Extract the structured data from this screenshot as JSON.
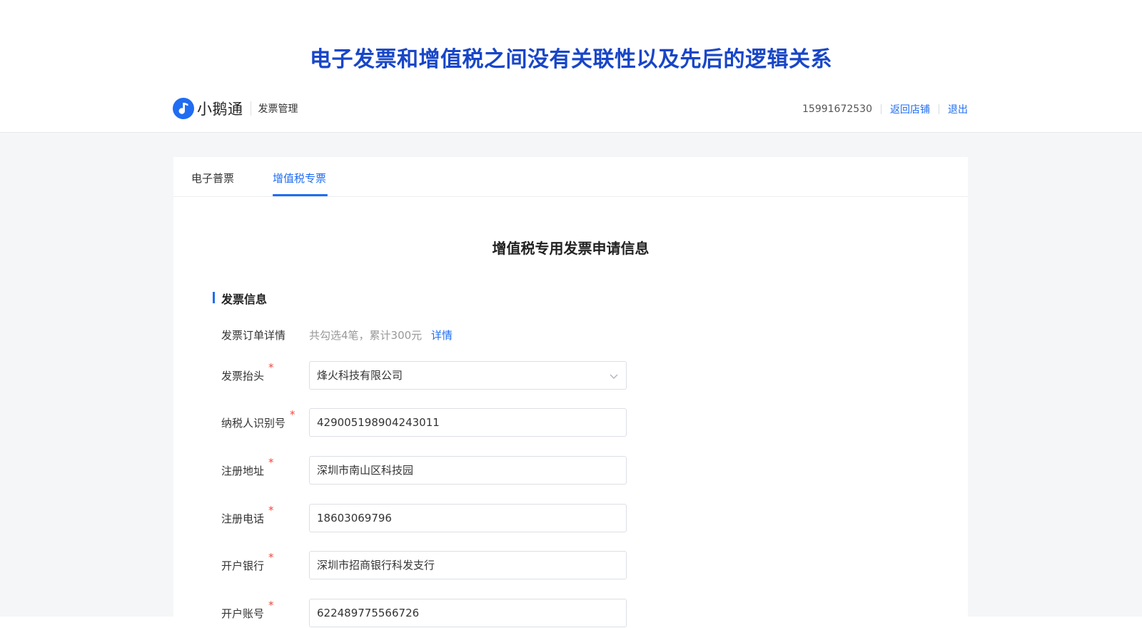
{
  "banner": {
    "title": "电子发票和增值税之间没有关联性以及先后的逻辑关系"
  },
  "header": {
    "logo_text": "小鹅通",
    "module_name": "发票管理",
    "phone": "15991672530",
    "back_link": "返回店铺",
    "logout_link": "退出"
  },
  "tabs": [
    {
      "label": "电子普票",
      "active": false
    },
    {
      "label": "增值税专票",
      "active": true
    }
  ],
  "form": {
    "title": "增值税专用发票申请信息",
    "section_title": "发票信息",
    "order_detail": {
      "label": "发票订单详情",
      "summary": "共勾选4笔，累计300元",
      "detail_link": "详情"
    },
    "fields": {
      "invoice_title": {
        "label": "发票抬头",
        "required_mark": "*",
        "value": "烽火科技有限公司"
      },
      "taxpayer_id": {
        "label": "纳税人识别号",
        "required_mark": "*",
        "value": "429005198904243011"
      },
      "reg_address": {
        "label": "注册地址",
        "required_mark": "*",
        "value": "深圳市南山区科技园"
      },
      "reg_phone": {
        "label": "注册电话",
        "required_mark": "*",
        "value": "18603069796"
      },
      "bank": {
        "label": "开户银行",
        "required_mark": "*",
        "value": "深圳市招商银行科发支行"
      },
      "account": {
        "label": "开户账号",
        "required_mark": "*",
        "value": "622489775566726"
      }
    }
  },
  "colors": {
    "accent": "#1f6df2",
    "banner_title": "#1846c8",
    "required": "#f0483e",
    "page_bg": "#f5f6f8"
  },
  "icons": {
    "logo": "note-logo-icon",
    "select": "chevron-down-icon"
  }
}
